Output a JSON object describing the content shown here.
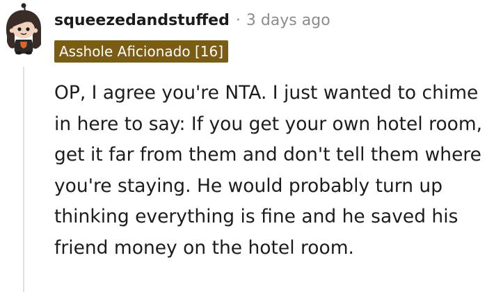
{
  "comment": {
    "author": "squeezedandstuffed",
    "separator": "·",
    "timestamp": "3 days ago",
    "flair": "Asshole Aficionado [16]",
    "body": "OP, I agree you're NTA. I just wanted to chime in here to say: If you get your own hotel room, get it far from them and don't tell them where you're staying. He would probably turn up thinking everything is fine and he saved his friend money on the hotel room."
  },
  "colors": {
    "flair_background": "#7a5c14",
    "muted_text": "#8a8c8e",
    "thread_line": "#e0e0e0"
  },
  "icons": {
    "avatar": "snoo-avatar-dark-hair"
  }
}
